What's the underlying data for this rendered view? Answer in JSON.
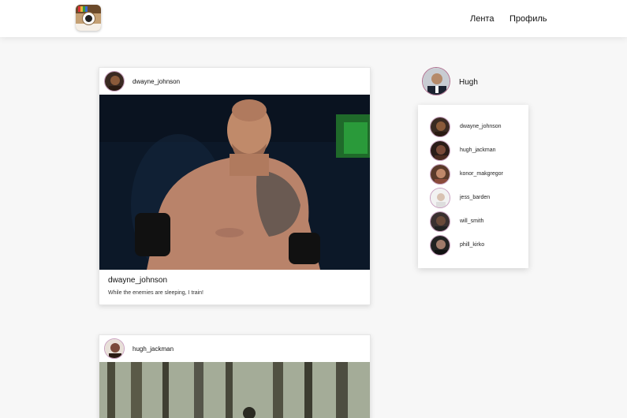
{
  "header": {
    "nav": {
      "feed": "Лента",
      "profile": "Профиль"
    }
  },
  "colors": {
    "accent_ring": "#c9a0c0",
    "background": "#f7f7f7"
  },
  "posts": [
    {
      "username": "dwayne_johnson",
      "caption_user": "dwayne_johnson",
      "caption": "While the enemies are sleeping, I train!",
      "image": "wrestler-photo"
    },
    {
      "username": "hugh_jackman",
      "caption_user": "",
      "caption": "",
      "image": "forest-photo"
    }
  ],
  "sidebar": {
    "current_user": "Hugh",
    "following": [
      {
        "username": "dwayne_johnson"
      },
      {
        "username": "hugh_jackman"
      },
      {
        "username": "konor_makgregor"
      },
      {
        "username": "jess_barden"
      },
      {
        "username": "will_smith"
      },
      {
        "username": "phill_kirko"
      }
    ]
  }
}
